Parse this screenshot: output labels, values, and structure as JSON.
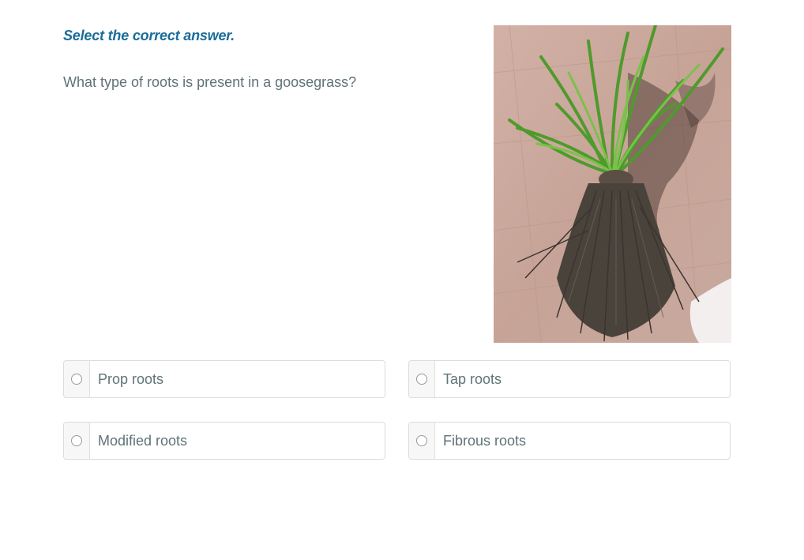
{
  "instruction": "Select the correct answer.",
  "question": "What type of roots is present in a goosegrass?",
  "image": {
    "subject": "goosegrass plant with roots on stone surface"
  },
  "options": [
    {
      "label": "Prop roots",
      "selected": false
    },
    {
      "label": "Tap roots",
      "selected": false
    },
    {
      "label": "Modified roots",
      "selected": false
    },
    {
      "label": "Fibrous roots",
      "selected": false
    }
  ],
  "colors": {
    "instruction": "#1a6c99",
    "text": "#5f7377",
    "border": "#dcdcdc"
  }
}
